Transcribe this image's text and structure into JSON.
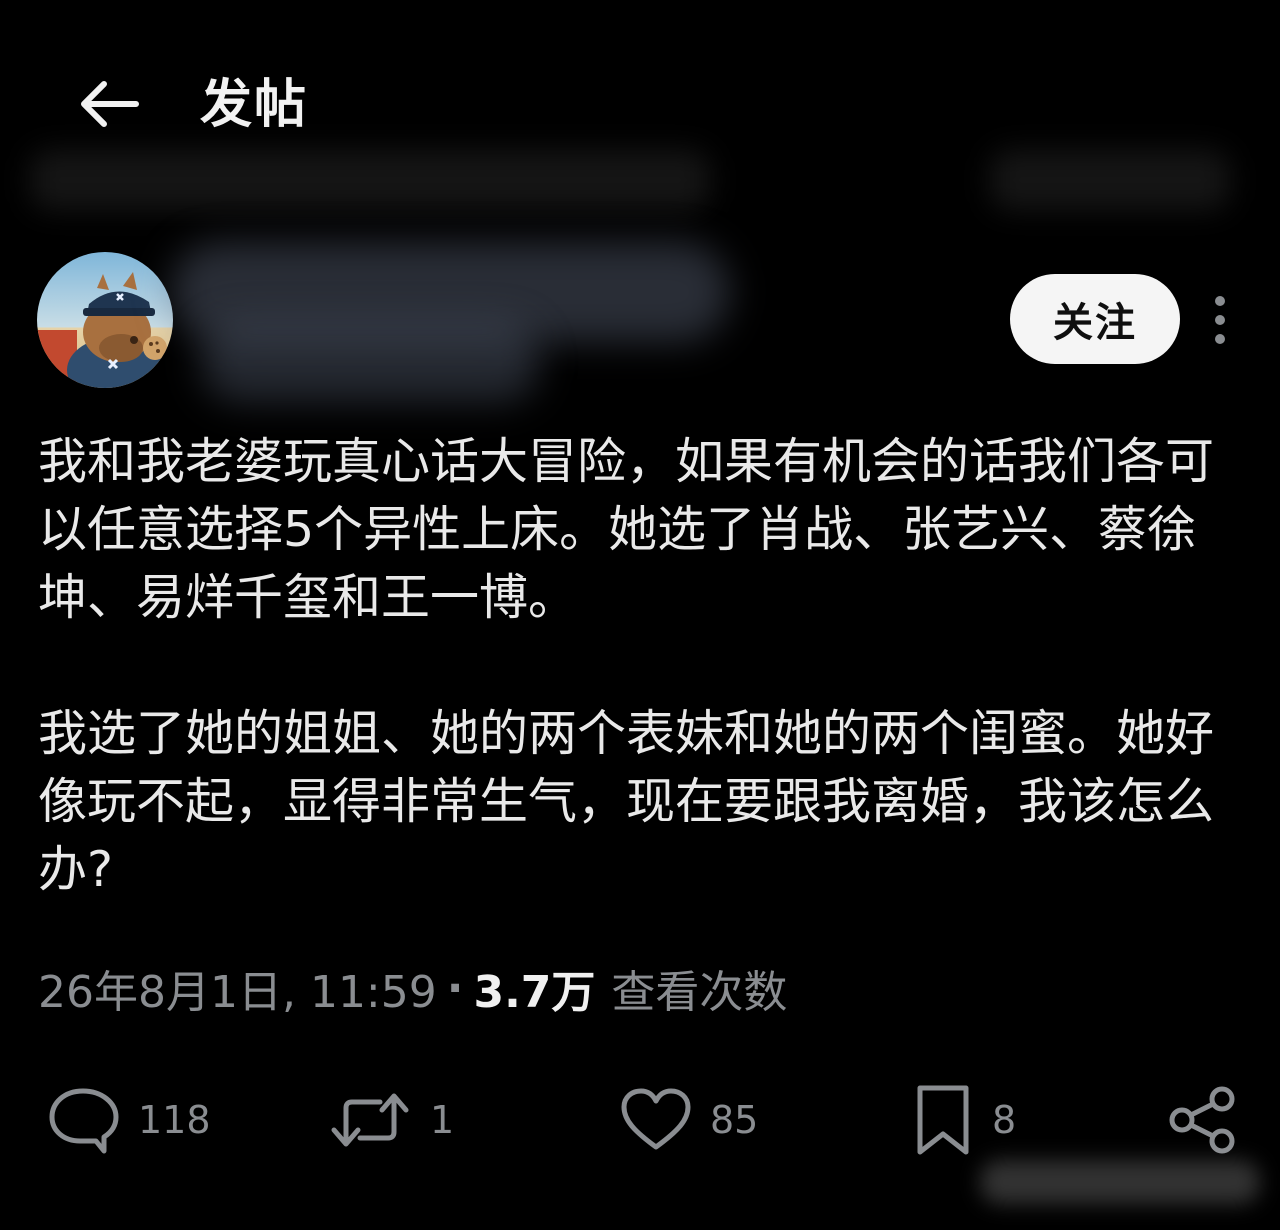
{
  "header": {
    "back_icon": "arrow-left-icon",
    "title": "发帖"
  },
  "author": {
    "avatar_icon": "capybara-avatar-icon",
    "follow_label": "关注",
    "more_icon": "vertical-ellipsis-icon"
  },
  "post": {
    "paragraph_1": "我和我老婆玩真心话大冒险，如果有机会的话我们各可以任意选择5个异性上床。她选了肖战、张艺兴、蔡徐坤、易烊千玺和王一博。",
    "paragraph_2": "我选了她的姐姐、她的两个表妹和她的两个闺蜜。她好像玩不起，显得非常生气，现在要跟我离婚，我该怎么办?"
  },
  "meta": {
    "timestamp": "26年8月1日, 11:59",
    "separator": "·",
    "views_count": "3.7万",
    "views_label": "查看次数"
  },
  "actions": {
    "reply": {
      "icon": "speech-bubble-icon",
      "count": "118"
    },
    "repost": {
      "icon": "repost-arrows-icon",
      "count": "1"
    },
    "like": {
      "icon": "heart-icon",
      "count": "85"
    },
    "bookmark": {
      "icon": "bookmark-icon",
      "count": "8"
    },
    "share": {
      "icon": "share-icon"
    }
  },
  "colors": {
    "background": "#000000",
    "text_primary": "#e9e9e9",
    "text_secondary": "#8a8d91",
    "follow_button_bg": "#f5f5f5"
  }
}
